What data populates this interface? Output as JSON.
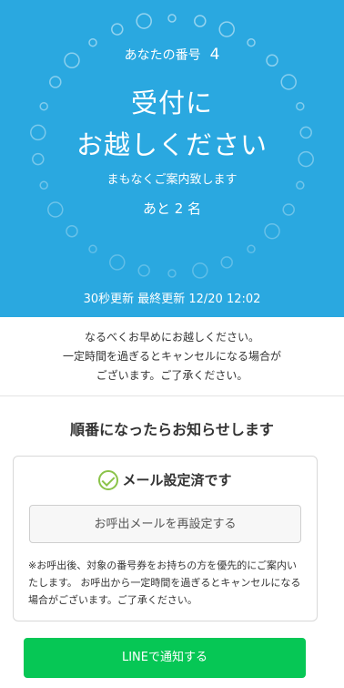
{
  "hero": {
    "number_label": "あなたの番号",
    "number_value": "4",
    "title_line1": "受付に",
    "title_line2": "お越しください",
    "subtitle": "まもなくご案内致します",
    "remaining": "あと 2 名",
    "updated": "30秒更新 最終更新 12/20 12:02",
    "bg_color": "#2aa8e0"
  },
  "notice": {
    "line1": "なるべくお早めにお越しください。",
    "line2": "一定時間を過ぎるとキャンセルになる場合が",
    "line3": "ございます。ご了承ください。"
  },
  "notify": {
    "title": "順番になったらお知らせします",
    "status": "メール設定済です",
    "status_icon": "check-circle-icon",
    "reset_label": "お呼出メールを再設定する",
    "note": "※お呼出後、対象の番号券をお持ちの方を優先的にご案内いたします。 お呼出から一定時間を過ぎるとキャンセルになる場合がございます。ご了承ください。"
  },
  "line_button": {
    "label": "LINEで通知する",
    "color": "#06c755"
  }
}
